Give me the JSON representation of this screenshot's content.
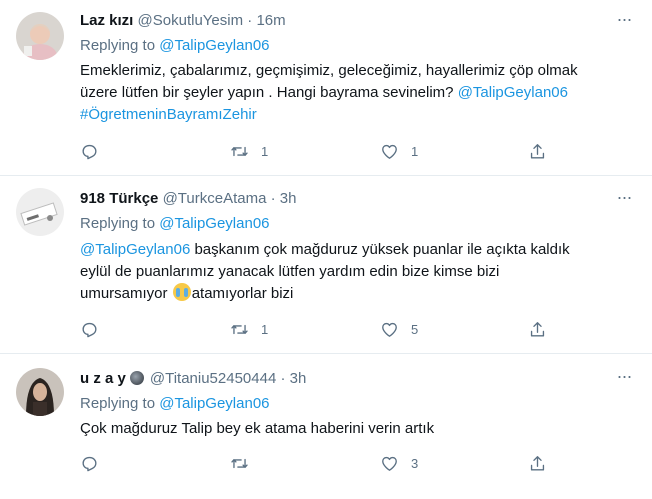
{
  "tweets": [
    {
      "name": "Laz kızı",
      "handle": "@SokutluYesim",
      "dot": "·",
      "time": "16m",
      "replying_prefix": "Replying to ",
      "replying_handle": "@TalipGeylan06",
      "text_line1": "Emeklerimiz, çabalarımız, geçmişimiz, geleceğimiz, hayallerimiz çöp olmak",
      "text_line2_a": "üzere lütfen bir şeyler yapın . Hangi bayrama sevinelim? ",
      "text_line2_mention": "@TalipGeylan06",
      "text_line3_hashtag": "#ÖgretmeninBayramıZehir",
      "reply_count": "",
      "retweet_count": "1",
      "like_count": "1"
    },
    {
      "name": "918 Türkçe",
      "handle": "@TurkceAtama",
      "dot": "·",
      "time": "3h",
      "replying_prefix": "Replying to ",
      "replying_handle": "@TalipGeylan06",
      "text_line1_mention": "@TalipGeylan06",
      "text_line1_rest": " başkanım çok mağduruz yüksek puanlar ile açıkta kaldık",
      "text_line2": "eylül de puanlarımız yanacak lütfen yardım edin bize kimse bizi",
      "text_line3_a": "umursamıyor ",
      "text_line3_b": "atamıyorlar bizi",
      "reply_count": "",
      "retweet_count": "1",
      "like_count": "5"
    },
    {
      "name": "u z a y",
      "handle": "@Titaniu52450444",
      "dot": "·",
      "time": "3h",
      "replying_prefix": "Replying to ",
      "replying_handle": "@TalipGeylan06",
      "text_line1": "Çok mağduruz Talip bey ek atama haberini verin artık",
      "reply_count": "",
      "retweet_count": "",
      "like_count": "3"
    }
  ],
  "icons": {
    "reply": "reply-icon",
    "retweet": "retweet-icon",
    "like": "heart-icon",
    "share": "share-icon",
    "more": "more-options-icon"
  },
  "colors": {
    "link": "#1b95e0",
    "secondary_text": "#5b7083",
    "primary_text": "#0f1419",
    "divider": "#e6ecf0"
  }
}
